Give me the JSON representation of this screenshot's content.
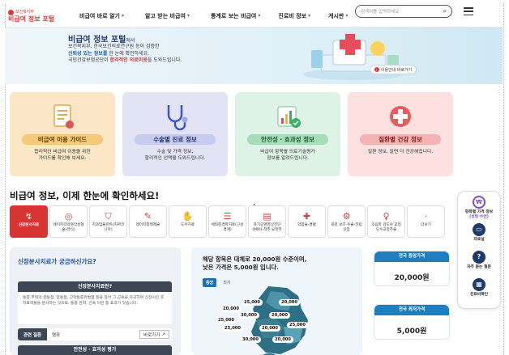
{
  "header": {
    "logo_top": "보건복지부",
    "logo_name": "비급여 정보 포털",
    "nav": [
      {
        "label": "비급여 바로 알기"
      },
      {
        "label": "알고 받는 비급여"
      },
      {
        "label": "통계로 보는 비급여"
      },
      {
        "label": "진료비 정보"
      },
      {
        "label": "게시판"
      }
    ],
    "search_placeholder": "검색어를 입력하세요."
  },
  "hero": {
    "title": "비급여 정보 포털",
    "title_suffix": "에서",
    "line1": "보건복지부, 한국보건의료연구원 등이 검증한",
    "line2_highlight": "신뢰성 있는 정보를",
    "line2_rest": " 한 눈에 확인하세요.",
    "line3_prefix": "국민건강보험공단이 ",
    "line3_highlight": "합리적인 의료이용",
    "line3_suffix": "을 도와드립니다.",
    "guide_button": "이용안내 바로가기"
  },
  "cards": [
    {
      "title": "비급여 이용 가이드",
      "desc1": "합리적인 비급여 이용을 위한",
      "desc2": "가이드를 확인해 보세요.",
      "icon": "document-icon"
    },
    {
      "title": "수술별 진료 정보",
      "desc1": "수술 및 가격 정보,",
      "desc2": "합리적인 선택을 도와드립니다.",
      "icon": "stethoscope-icon"
    },
    {
      "title": "안전성 · 효과성 정보",
      "desc1": "비급여 항목별 의료기술평가",
      "desc2": "정보를 알려드립니다.",
      "icon": "chart-check-icon"
    },
    {
      "title": "질환별 건강 정보",
      "desc1": "질환 정보, 알면 더 건강해집니다.",
      "desc2": "",
      "icon": "medical-cross-icon"
    }
  ],
  "section_title": "비급여 정보, 이제 한눈에 확인하세요!",
  "categories": [
    {
      "label": "신장분사치료",
      "icon": "↯",
      "active": true
    },
    {
      "label": "레이저각막절삭성형술(라식)",
      "icon": "◎",
      "active": false
    },
    {
      "label": "치과임플란트(지르코니아)",
      "icon": "⛉",
      "active": false
    },
    {
      "label": "레이저창백제술",
      "icon": "✎",
      "active": false
    },
    {
      "label": "도수치료",
      "icon": "✋",
      "active": false
    },
    {
      "label": "체외충격파치료(근골격계)",
      "icon": "☰",
      "active": false
    },
    {
      "label": "자기공명영상진단(MRI)-척추·요천추",
      "icon": "▤",
      "active": false
    },
    {
      "label": "약침술-경혈",
      "icon": "✚",
      "active": false
    },
    {
      "label": "로봇 보조 수술-전립선암",
      "icon": "⚙",
      "active": false
    },
    {
      "label": "초음파 검도수 교정 도수교정추술",
      "icon": "♀",
      "active": false
    },
    {
      "label": "더보기",
      "icon": "·",
      "active": false
    }
  ],
  "quick_menu": [
    {
      "label1": "항목별 가격 정보",
      "label2": "(성형·수면)",
      "icon": "₩"
    },
    {
      "label1": "자료실",
      "label2": "",
      "icon": "▭"
    },
    {
      "label1": "자주 묻는 질문",
      "label2": "",
      "icon": "?"
    },
    {
      "label1": "진료비확인",
      "label2": "",
      "icon": "▦"
    }
  ],
  "left_panel": {
    "question": "신장분사치료가 궁금하신가요?",
    "dark_header": "신장분사치료란?",
    "body": "통증 부위의 운동점, 압통점, 근막통증유발점 등을 찾아 그 근육을 자극하여 신장시킨 후 치료약물을 분사하는 것으로, 통증 완화, 근육 이완 등 효과가 있습니다.",
    "row_tag": "관련 질환",
    "row_value": "염좌",
    "row_link": "바로가기",
    "dark_header2": "안전성 · 효과성 평가"
  },
  "map_panel": {
    "line1": "해당 항목은 대체로 20,000원 수준이며,",
    "line2": "낮은 가격은 5,000원 입니다.",
    "tab_on": "중앙",
    "tab_off": "최저",
    "prices": [
      "20,000",
      "25,000",
      "20,000",
      "25,000",
      "30,000",
      "20,000",
      "25,000",
      "20,000",
      "25,000",
      "30,000",
      "20,000"
    ]
  },
  "price_boxes": [
    {
      "header": "전국 중앙가격",
      "value": "20,000원"
    },
    {
      "header": "전국 최저가격",
      "value": "5,000원"
    }
  ],
  "colors": {
    "brand_red": "#d93434",
    "nav_blue": "#1f7ec0",
    "dark_panel": "#3d4655"
  }
}
